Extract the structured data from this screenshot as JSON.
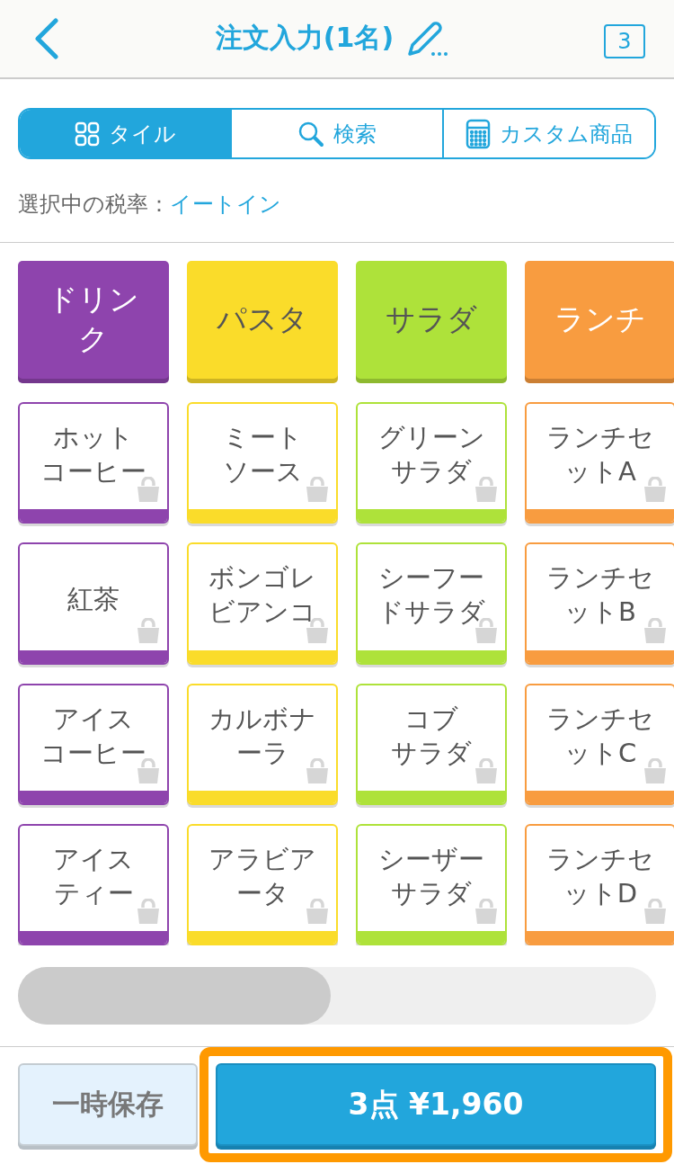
{
  "header": {
    "title": "注文入力(1名)",
    "badge": "3"
  },
  "tabs": [
    {
      "kind": "tile",
      "label": "タイル",
      "selected": true
    },
    {
      "kind": "search",
      "label": "検索",
      "selected": false
    },
    {
      "kind": "calculator",
      "label": "カスタム商品",
      "selected": false
    }
  ],
  "tax": {
    "label": "選択中の税率：",
    "value": "イートイン"
  },
  "categories": [
    {
      "lines": [
        "ドリン",
        "ク"
      ],
      "color": "#8e44ad",
      "items": [
        {
          "lines": [
            "ホット",
            "コーヒー"
          ]
        },
        {
          "lines": [
            "紅茶"
          ]
        },
        {
          "lines": [
            "アイス",
            "コーヒー"
          ]
        },
        {
          "lines": [
            "アイス",
            "ティー"
          ]
        }
      ]
    },
    {
      "lines": [
        "パスタ"
      ],
      "color": "#fadc2a",
      "items": [
        {
          "lines": [
            "ミート",
            "ソース"
          ]
        },
        {
          "lines": [
            "ボンゴレ",
            "ビアンコ"
          ]
        },
        {
          "lines": [
            "カルボナ",
            "ーラ"
          ]
        },
        {
          "lines": [
            "アラビア",
            "ータ"
          ]
        }
      ]
    },
    {
      "lines": [
        "サラダ"
      ],
      "color": "#aee23a",
      "items": [
        {
          "lines": [
            "グリーン",
            "サラダ"
          ]
        },
        {
          "lines": [
            "シーフー",
            "ドサラダ"
          ]
        },
        {
          "lines": [
            "コブ",
            "サラダ"
          ]
        },
        {
          "lines": [
            "シーザー",
            "サラダ"
          ]
        }
      ]
    },
    {
      "lines": [
        "ランチ"
      ],
      "color": "#f89c40",
      "items": [
        {
          "lines": [
            "ランチセ",
            "ットA"
          ]
        },
        {
          "lines": [
            "ランチセ",
            "ットB"
          ]
        },
        {
          "lines": [
            "ランチセ",
            "ットC"
          ]
        },
        {
          "lines": [
            "ランチセ",
            "ットD"
          ]
        }
      ]
    }
  ],
  "footer": {
    "save": "一時保存",
    "checkout": "3点 ¥1,960"
  }
}
